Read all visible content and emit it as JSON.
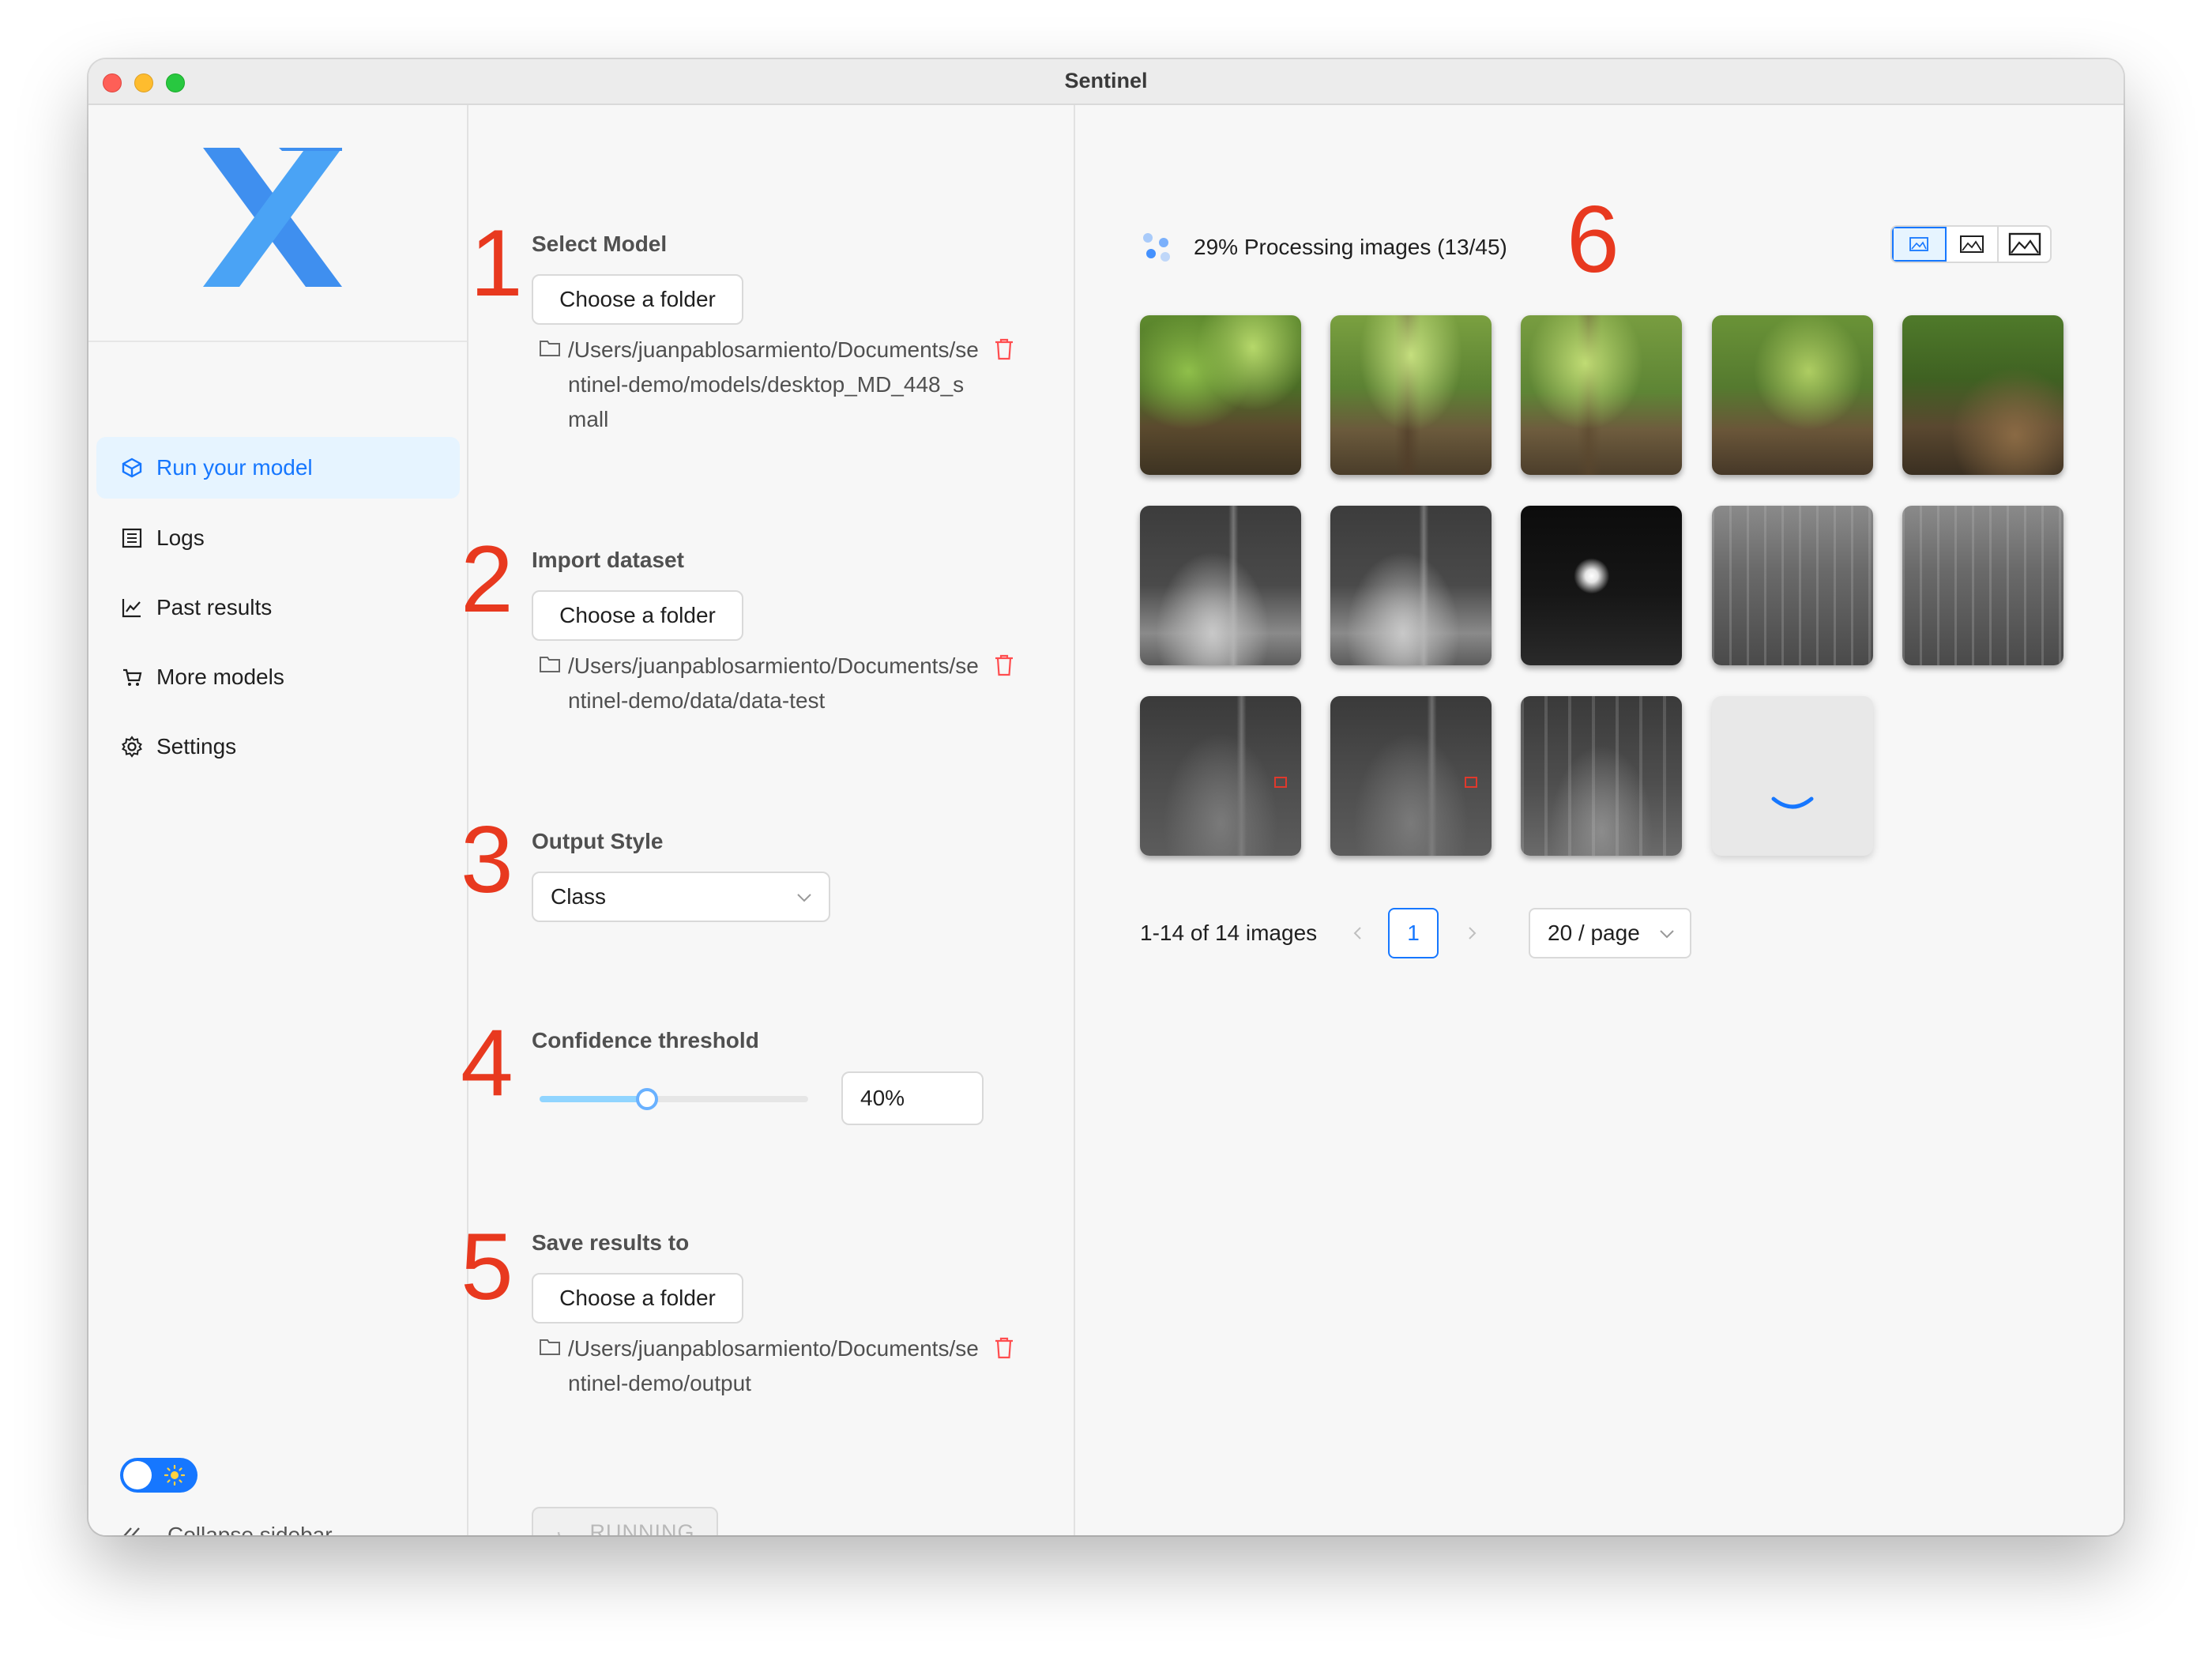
{
  "window": {
    "title": "Sentinel"
  },
  "sidebar": {
    "logo": "x-logo",
    "items": [
      {
        "label": "Run your model",
        "icon": "cube-icon",
        "active": true
      },
      {
        "label": "Logs",
        "icon": "log-list-icon",
        "active": false
      },
      {
        "label": "Past results",
        "icon": "line-chart-icon",
        "active": false
      },
      {
        "label": "More models",
        "icon": "cart-icon",
        "active": false
      },
      {
        "label": "Settings",
        "icon": "gear-icon",
        "active": false
      }
    ],
    "theme_toggle": {
      "state": "light",
      "icon": "sun-icon"
    },
    "collapse_label": "Collapse sidebar"
  },
  "form": {
    "steps": [
      {
        "number": "1",
        "label": "Select Model",
        "button": "Choose a folder",
        "path": "/Users/juanpablosarmiento/Documents/sentinel-demo/models/desktop_MD_448_small"
      },
      {
        "number": "2",
        "label": "Import dataset",
        "button": "Choose a folder",
        "path": "/Users/juanpablosarmiento/Documents/sentinel-demo/data/data-test"
      },
      {
        "number": "3",
        "label": "Output Style",
        "select_value": "Class"
      },
      {
        "number": "4",
        "label": "Confidence threshold",
        "value": "40%",
        "slider_fraction": 0.4
      },
      {
        "number": "5",
        "label": "Save results to",
        "button": "Choose a folder",
        "path": "/Users/juanpablosarmiento/Documents/sentinel-demo/output"
      }
    ],
    "run_button": "RUNNING"
  },
  "results": {
    "step_number": "6",
    "progress_text": "29% Processing images (13/45)",
    "view_modes": [
      "small-image-icon",
      "medium-image-icon",
      "large-image-icon"
    ],
    "active_view": 0,
    "images_loaded": 13,
    "pagination": {
      "total_label": "1-14 of 14 images",
      "current_page": "1",
      "page_size": "20 / page"
    }
  },
  "colors": {
    "accent": "#1677ff",
    "step_number": "#e8391f",
    "danger": "#ff4d4f"
  }
}
